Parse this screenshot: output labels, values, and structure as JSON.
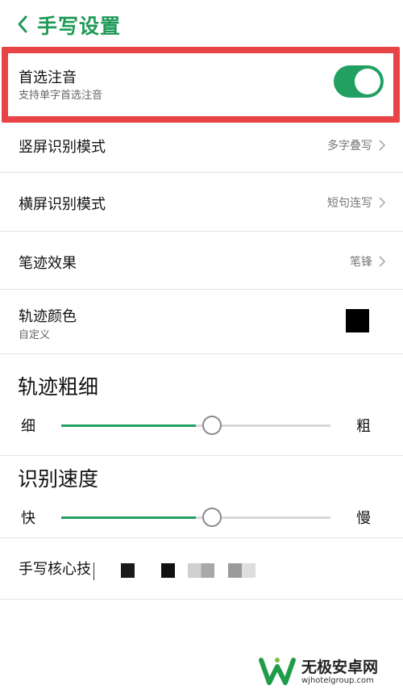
{
  "header": {
    "title": "手写设置"
  },
  "items": {
    "prefer_pinyin": {
      "label": "首选注音",
      "sub": "支持单字首选注音",
      "enabled": true
    },
    "portrait_mode": {
      "label": "竖屏识别模式",
      "value": "多字叠写"
    },
    "landscape_mode": {
      "label": "横屏识别模式",
      "value": "短句连写"
    },
    "stroke_effect": {
      "label": "笔迹效果",
      "value": "笔锋"
    },
    "trace_color": {
      "label": "轨迹颜色",
      "sub": "自定义",
      "color": "#000000"
    }
  },
  "thickness": {
    "title": "轨迹粗细",
    "min_label": "细",
    "max_label": "粗",
    "level": 0.5
  },
  "speed": {
    "title": "识别速度",
    "min_label": "快",
    "max_label": "慢",
    "level": 0.5
  },
  "core_tech": {
    "label": "手写核心技"
  },
  "colors": {
    "accent": "#21a062",
    "highlight": "#e84447"
  },
  "watermark": {
    "name": "无极安卓网",
    "url": "wjhotelgroup.com"
  }
}
